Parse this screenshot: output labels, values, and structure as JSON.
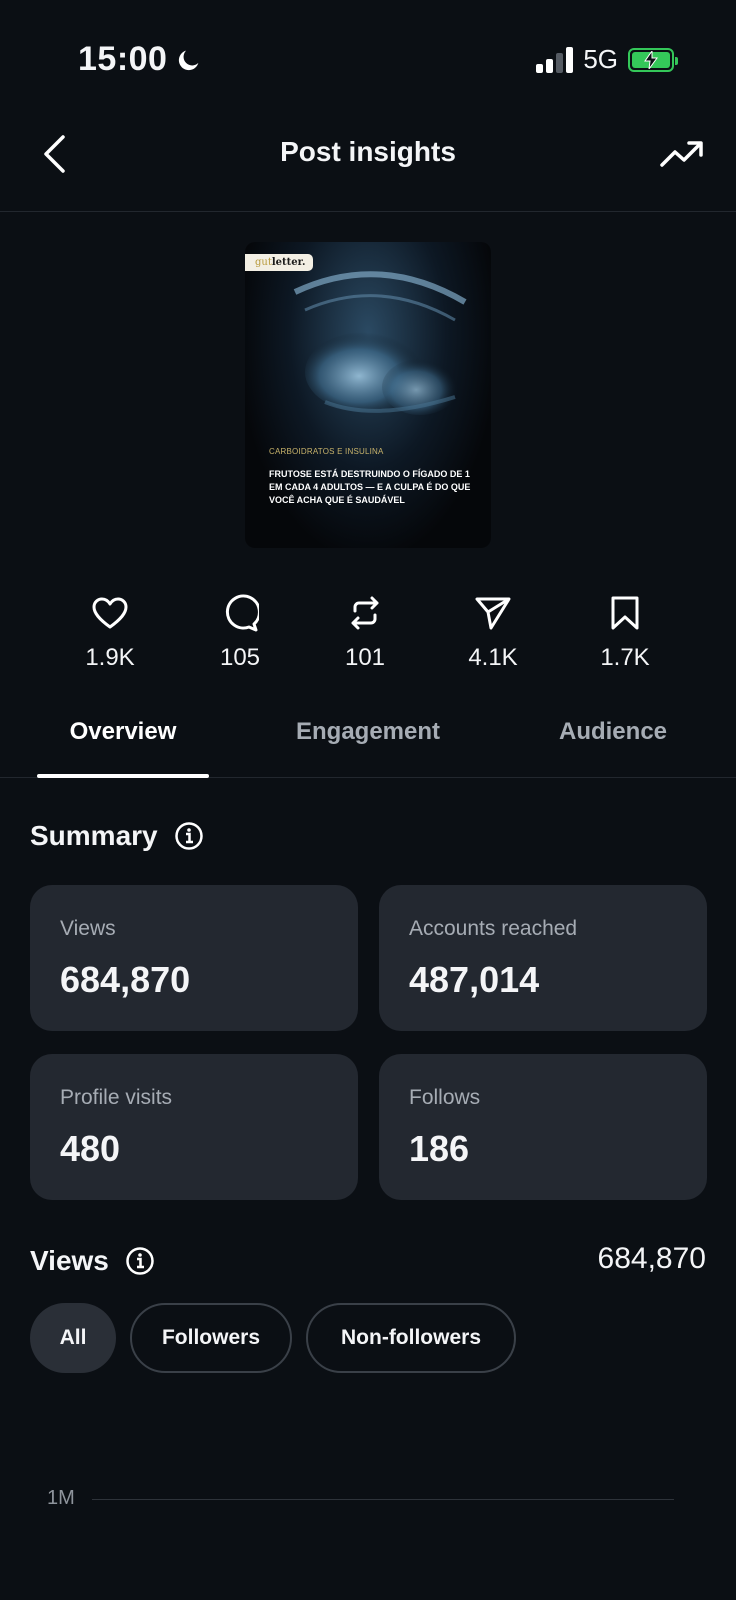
{
  "status_bar": {
    "time": "15:00",
    "network": "5G"
  },
  "header": {
    "title": "Post insights"
  },
  "post": {
    "brand": {
      "prefix": "gut",
      "suffix": "letter."
    },
    "kicker": "CARBOIDRATOS E INSULINA",
    "headline": "FRUTOSE ESTÁ DESTRUINDO O FÍGADO DE 1 EM CADA 4 ADULTOS — E A CULPA É DO QUE VOCÊ ACHA QUE É SAUDÁVEL"
  },
  "stats": {
    "likes": "1.9K",
    "comments": "105",
    "reposts": "101",
    "shares": "4.1K",
    "saves": "1.7K"
  },
  "tabs": [
    "Overview",
    "Engagement",
    "Audience"
  ],
  "active_tab": "Overview",
  "summary": {
    "title": "Summary",
    "cards": [
      {
        "label": "Views",
        "value": "684,870"
      },
      {
        "label": "Accounts reached",
        "value": "487,014"
      },
      {
        "label": "Profile visits",
        "value": "480"
      },
      {
        "label": "Follows",
        "value": "186"
      }
    ]
  },
  "views_section": {
    "title": "Views",
    "total": "684,870",
    "filters": [
      "All",
      "Followers",
      "Non-followers"
    ],
    "selected_filter": "All",
    "chart_y_tick": "1M"
  },
  "colors": {
    "background": "#0b0f14",
    "card": "#232830",
    "battery": "#34c759",
    "muted_text": "#a6acb4"
  }
}
